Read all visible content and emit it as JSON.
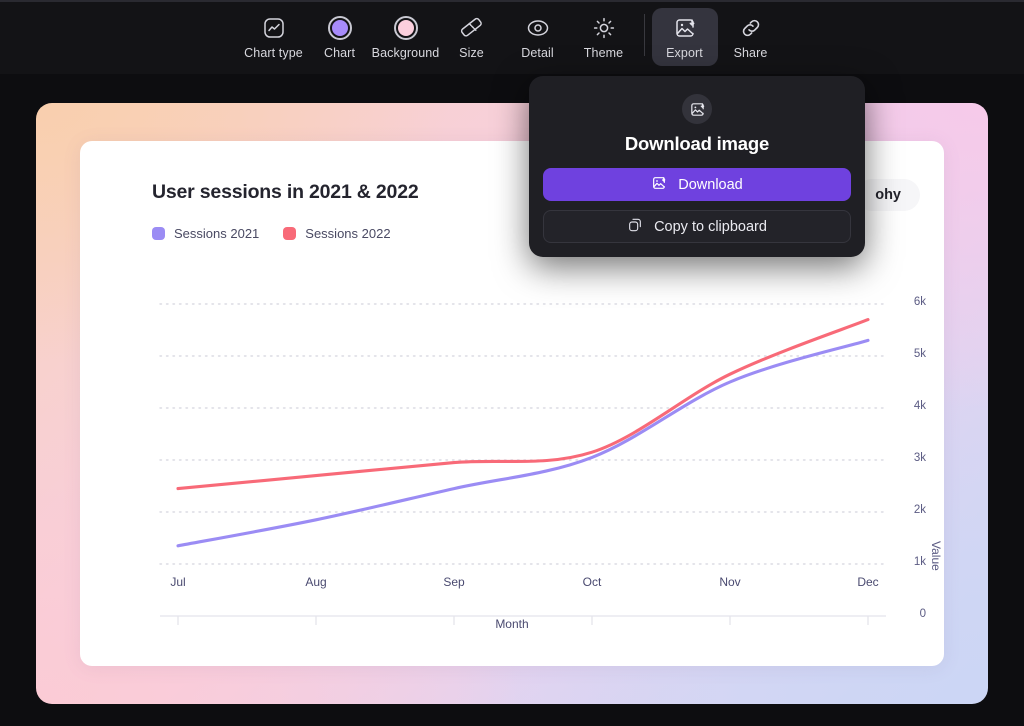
{
  "toolbar": {
    "items": [
      {
        "label": "Chart type",
        "icon": "chart-type-icon",
        "active": false
      },
      {
        "label": "Chart",
        "icon": "chart-color-swatch-icon",
        "active": false,
        "color": "#a78bfa"
      },
      {
        "label": "Background",
        "icon": "background-color-swatch-icon",
        "active": false,
        "color": "#fbcfdd"
      },
      {
        "label": "Size",
        "icon": "ruler-icon",
        "active": false
      },
      {
        "label": "Detail",
        "icon": "eye-icon",
        "active": false
      },
      {
        "label": "Theme",
        "icon": "sun-icon",
        "active": false
      },
      {
        "label": "Export",
        "icon": "export-image-icon",
        "active": true
      },
      {
        "label": "Share",
        "icon": "link-icon",
        "active": false
      }
    ]
  },
  "popover": {
    "icon": "image-download-icon",
    "title": "Download image",
    "download_label": "Download",
    "download_icon": "image-download-icon",
    "copy_label": "Copy to clipboard",
    "copy_icon": "copy-icon",
    "accent_color": "#6f41df"
  },
  "card": {
    "title": "User sessions in 2021 & 2022",
    "typography_chip": "ohy",
    "legend": [
      {
        "label": "Sessions 2021",
        "color": "#9b8cf4"
      },
      {
        "label": "Sessions 2022",
        "color": "#f86a78"
      }
    ]
  },
  "chart_data": {
    "type": "line",
    "title": "User sessions in 2021 & 2022",
    "xlabel": "Month",
    "ylabel": "Value",
    "categories": [
      "Jul",
      "Aug",
      "Sep",
      "Oct",
      "Nov",
      "Dec"
    ],
    "ytick_labels": [
      "0",
      "1k",
      "2k",
      "3k",
      "4k",
      "5k",
      "6k"
    ],
    "ytick_values": [
      0,
      1000,
      2000,
      3000,
      4000,
      5000,
      6000
    ],
    "ylim": [
      0,
      6000
    ],
    "grid": true,
    "legend_position": "top-left",
    "series": [
      {
        "name": "Sessions 2021",
        "color": "#9b8cf4",
        "values": [
          1350,
          1850,
          2450,
          3050,
          4500,
          5300
        ]
      },
      {
        "name": "Sessions 2022",
        "color": "#f86a78",
        "values": [
          2450,
          2700,
          2950,
          3150,
          4650,
          5700
        ]
      }
    ]
  },
  "background": {
    "page": "#0d0d10",
    "toolbar": "#131316",
    "gradient_corners": [
      "#f9cfae",
      "#f6caea",
      "#fbcbd5",
      "#ccd6f5"
    ]
  }
}
